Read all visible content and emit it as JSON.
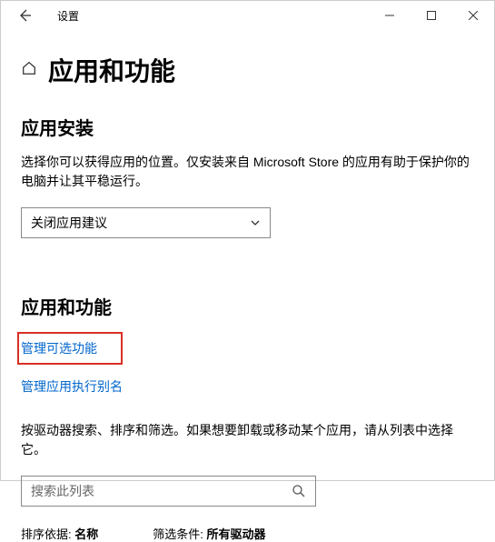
{
  "window": {
    "title": "设置"
  },
  "page": {
    "title": "应用和功能"
  },
  "install": {
    "heading": "应用安装",
    "description": "选择你可以获得应用的位置。仅安装来自 Microsoft Store 的应用有助于保护你的电脑并让其平稳运行。",
    "dropdown_value": "关闭应用建议"
  },
  "features": {
    "heading": "应用和功能",
    "link_optional": "管理可选功能",
    "link_alias": "管理应用执行别名",
    "description": "按驱动器搜索、排序和筛选。如果想要卸载或移动某个应用，请从列表中选择它。",
    "search_placeholder": "搜索此列表"
  },
  "sort": {
    "label": "排序依据:",
    "value": "名称"
  },
  "filter": {
    "label": "筛选条件:",
    "value": "所有驱动器"
  }
}
